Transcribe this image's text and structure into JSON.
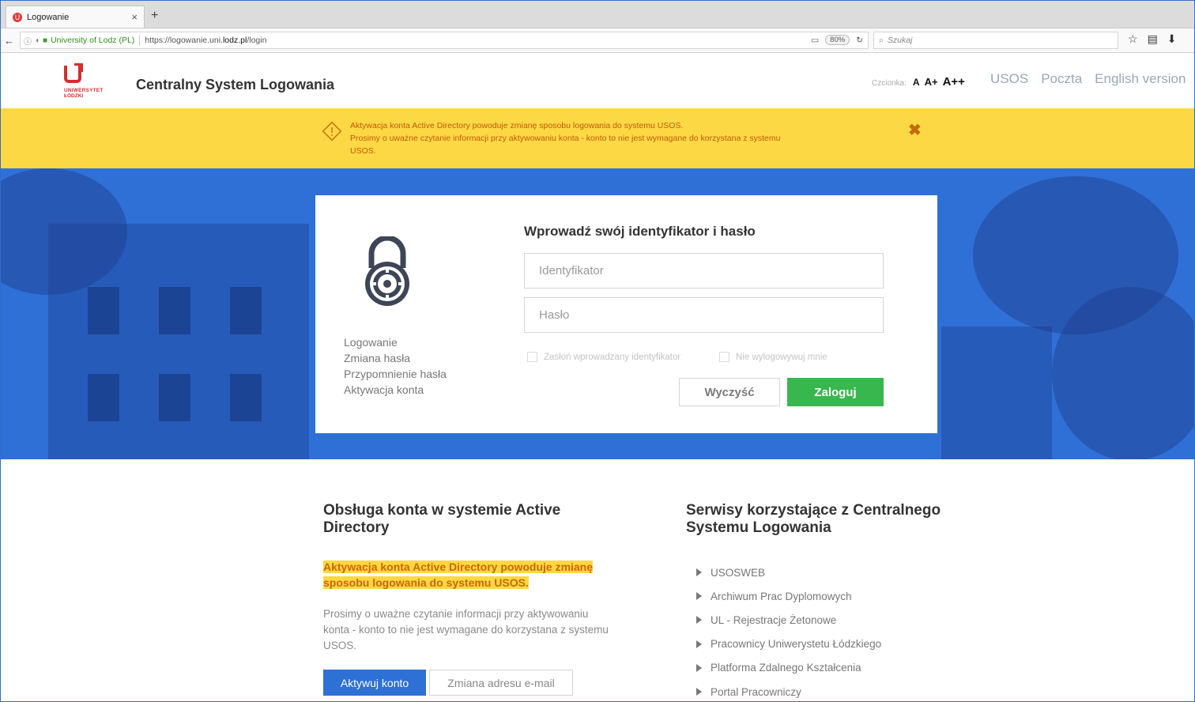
{
  "browser": {
    "tab_title": "Logowanie",
    "tab_close": "×",
    "new_tab": "+",
    "org": "University of Lodz (PL)",
    "url_prefix": "https://logowanie.uni.",
    "url_domain": "lodz.pl",
    "url_path": "/login",
    "zoom": "80%",
    "search_placeholder": "Szukaj"
  },
  "header": {
    "logo_line1": "UNIWERSYTET",
    "logo_line2": "ŁÓDZKI",
    "title": "Centralny System Logowania",
    "font_label": "Czcionka:",
    "font_sizes": [
      "A",
      "A+",
      "A++"
    ],
    "links": [
      "USOS",
      "Poczta",
      "English version"
    ]
  },
  "notice": {
    "line1": "Aktywacja konta Active Directory powoduje zmianę sposobu logowania do systemu USOS.",
    "line2": "Prosimy o uważne czytanie informacji przy aktywowaniu konta - konto to nie jest wymagane do korzystana z systemu USOS.",
    "close": "✖"
  },
  "login": {
    "side_menu": [
      "Logowanie",
      "Zmiana hasła",
      "Przypomnienie hasła",
      "Aktywacja konta"
    ],
    "title": "Wprowadź swój identyfikator i hasło",
    "id_placeholder": "Identyfikator",
    "pass_placeholder": "Hasło",
    "hide_id_label": "Zasłoń wprowadzany identyfikator",
    "stay_logged_label": "Nie wylogowywuj mnie",
    "clear_label": "Wyczyść",
    "login_label": "Zaloguj"
  },
  "ad": {
    "title": "Obsługa konta w systemie Active Directory",
    "highlight": "Aktywacja konta Active Directory powoduje zmianę sposobu logowania do systemu USOS.",
    "text": "Prosimy o uważne czytanie informacji przy aktywowaniu konta - konto to nie jest wymagane do korzystana z systemu USOS.",
    "activate_label": "Aktywuj konto",
    "email_label": "Zmiana adresu e-mail"
  },
  "services": {
    "title": "Serwisy korzystające z Centralnego Systemu Logowania",
    "items": [
      "USOSWEB",
      "Archiwum Prac Dyplomowych",
      "UL - Rejestracje Żetonowe",
      "Pracownicy Uniwerystetu Łódzkiego",
      "Platforma Zdalnego Kształcenia",
      "Portal Pracowniczy"
    ]
  },
  "colors": {
    "brand_red": "#d42e2e",
    "hero_blue": "#2e70d6",
    "notice_yellow": "#fcd845",
    "login_green": "#39b74f"
  }
}
